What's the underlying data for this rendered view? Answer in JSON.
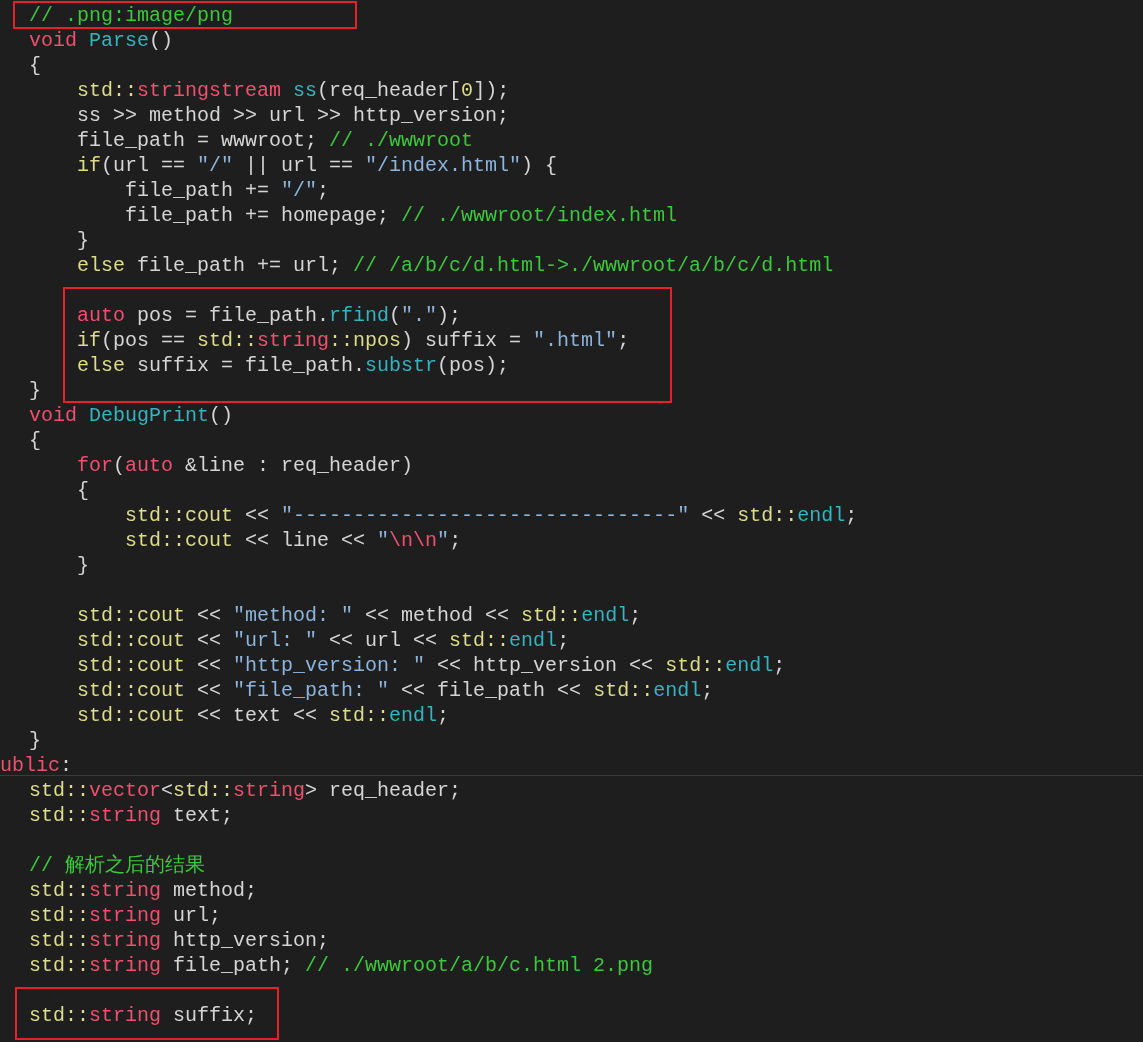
{
  "editor": {
    "lines": [
      {
        "kind": "code",
        "tokens": [
          {
            "text": "// .png:image/png",
            "kind": "comment"
          }
        ]
      },
      {
        "kind": "code",
        "tokens": [
          {
            "text": "void",
            "kind": "keyword"
          },
          {
            "text": " Parse",
            "kind": "func"
          },
          {
            "text": "()",
            "kind": "plain"
          }
        ]
      },
      {
        "kind": "code",
        "tokens": [
          {
            "text": "{",
            "kind": "plain"
          }
        ]
      },
      {
        "kind": "code",
        "tokens": [
          {
            "text": "    std::",
            "kind": "ns"
          },
          {
            "text": "stringstream",
            "kind": "keyword"
          },
          {
            "text": " ss",
            "kind": "func"
          },
          {
            "text": "(req_header[",
            "kind": "plain"
          },
          {
            "text": "0",
            "kind": "ns"
          },
          {
            "text": "]);",
            "kind": "plain"
          }
        ]
      },
      {
        "kind": "code",
        "tokens": [
          {
            "text": "    ss >> method >> url >> http_version;",
            "kind": "plain"
          }
        ]
      },
      {
        "kind": "code",
        "tokens": [
          {
            "text": "    file_path = wwwroot; ",
            "kind": "plain"
          },
          {
            "text": "// ./wwwroot",
            "kind": "comment"
          }
        ]
      },
      {
        "kind": "code",
        "tokens": [
          {
            "text": "    if",
            "kind": "ns"
          },
          {
            "text": "(url == ",
            "kind": "plain"
          },
          {
            "text": "\"/\"",
            "kind": "string"
          },
          {
            "text": " || url == ",
            "kind": "plain"
          },
          {
            "text": "\"/index.html\"",
            "kind": "string"
          },
          {
            "text": ") {",
            "kind": "plain"
          }
        ]
      },
      {
        "kind": "code",
        "tokens": [
          {
            "text": "        file_path += ",
            "kind": "plain"
          },
          {
            "text": "\"/\"",
            "kind": "string"
          },
          {
            "text": ";",
            "kind": "plain"
          }
        ]
      },
      {
        "kind": "code",
        "tokens": [
          {
            "text": "        file_path += homepage; ",
            "kind": "plain"
          },
          {
            "text": "// ./wwwroot/index.html",
            "kind": "comment"
          }
        ]
      },
      {
        "kind": "code",
        "tokens": [
          {
            "text": "    }",
            "kind": "plain"
          }
        ]
      },
      {
        "kind": "code",
        "tokens": [
          {
            "text": "    else",
            "kind": "ns"
          },
          {
            "text": " file_path += url; ",
            "kind": "plain"
          },
          {
            "text": "// /a/b/c/d.html->./wwwroot/a/b/c/d.html",
            "kind": "comment"
          }
        ]
      },
      {
        "kind": "blank"
      },
      {
        "kind": "code",
        "tokens": [
          {
            "text": "    auto",
            "kind": "keyword"
          },
          {
            "text": " pos = file_path.",
            "kind": "plain"
          },
          {
            "text": "rfind",
            "kind": "func"
          },
          {
            "text": "(",
            "kind": "plain"
          },
          {
            "text": "\".\"",
            "kind": "string"
          },
          {
            "text": ");",
            "kind": "plain"
          }
        ]
      },
      {
        "kind": "code",
        "tokens": [
          {
            "text": "    if",
            "kind": "ns"
          },
          {
            "text": "(pos == ",
            "kind": "plain"
          },
          {
            "text": "std::",
            "kind": "ns"
          },
          {
            "text": "string",
            "kind": "keyword"
          },
          {
            "text": "::npos",
            "kind": "ns"
          },
          {
            "text": ") suffix = ",
            "kind": "plain"
          },
          {
            "text": "\".html\"",
            "kind": "string"
          },
          {
            "text": ";",
            "kind": "plain"
          }
        ]
      },
      {
        "kind": "code",
        "tokens": [
          {
            "text": "    else",
            "kind": "ns"
          },
          {
            "text": " suffix = file_path.",
            "kind": "plain"
          },
          {
            "text": "substr",
            "kind": "func"
          },
          {
            "text": "(pos);",
            "kind": "plain"
          }
        ]
      },
      {
        "kind": "code",
        "tokens": [
          {
            "text": "}",
            "kind": "plain"
          }
        ]
      },
      {
        "kind": "code",
        "tokens": [
          {
            "text": "void",
            "kind": "keyword"
          },
          {
            "text": " DebugPrint",
            "kind": "func"
          },
          {
            "text": "()",
            "kind": "plain"
          }
        ]
      },
      {
        "kind": "code",
        "tokens": [
          {
            "text": "{",
            "kind": "plain"
          }
        ]
      },
      {
        "kind": "code",
        "tokens": [
          {
            "text": "    for",
            "kind": "keyword"
          },
          {
            "text": "(",
            "kind": "plain"
          },
          {
            "text": "auto",
            "kind": "keyword"
          },
          {
            "text": " &line : req_header)",
            "kind": "plain"
          }
        ]
      },
      {
        "kind": "code",
        "tokens": [
          {
            "text": "    {",
            "kind": "plain"
          }
        ]
      },
      {
        "kind": "code",
        "tokens": [
          {
            "text": "        std::cout",
            "kind": "ns"
          },
          {
            "text": " << ",
            "kind": "plain"
          },
          {
            "text": "\"--------------------------------\"",
            "kind": "string"
          },
          {
            "text": " << ",
            "kind": "plain"
          },
          {
            "text": "std::",
            "kind": "ns"
          },
          {
            "text": "endl",
            "kind": "func"
          },
          {
            "text": ";",
            "kind": "plain"
          }
        ]
      },
      {
        "kind": "code",
        "tokens": [
          {
            "text": "        std::cout",
            "kind": "ns"
          },
          {
            "text": " << line << ",
            "kind": "plain"
          },
          {
            "text": "\"",
            "kind": "string"
          },
          {
            "text": "\\n\\n",
            "kind": "escape"
          },
          {
            "text": "\"",
            "kind": "string"
          },
          {
            "text": ";",
            "kind": "plain"
          }
        ]
      },
      {
        "kind": "code",
        "tokens": [
          {
            "text": "    }",
            "kind": "plain"
          }
        ]
      },
      {
        "kind": "blank"
      },
      {
        "kind": "code",
        "tokens": [
          {
            "text": "    std::cout",
            "kind": "ns"
          },
          {
            "text": " << ",
            "kind": "plain"
          },
          {
            "text": "\"method: \"",
            "kind": "string"
          },
          {
            "text": " << method << ",
            "kind": "plain"
          },
          {
            "text": "std::",
            "kind": "ns"
          },
          {
            "text": "endl",
            "kind": "func"
          },
          {
            "text": ";",
            "kind": "plain"
          }
        ]
      },
      {
        "kind": "code",
        "tokens": [
          {
            "text": "    std::cout",
            "kind": "ns"
          },
          {
            "text": " << ",
            "kind": "plain"
          },
          {
            "text": "\"url: \"",
            "kind": "string"
          },
          {
            "text": " << url << ",
            "kind": "plain"
          },
          {
            "text": "std::",
            "kind": "ns"
          },
          {
            "text": "endl",
            "kind": "func"
          },
          {
            "text": ";",
            "kind": "plain"
          }
        ]
      },
      {
        "kind": "code",
        "tokens": [
          {
            "text": "    std::cout",
            "kind": "ns"
          },
          {
            "text": " << ",
            "kind": "plain"
          },
          {
            "text": "\"http_version: \"",
            "kind": "string"
          },
          {
            "text": " << http_version << ",
            "kind": "plain"
          },
          {
            "text": "std::",
            "kind": "ns"
          },
          {
            "text": "endl",
            "kind": "func"
          },
          {
            "text": ";",
            "kind": "plain"
          }
        ]
      },
      {
        "kind": "code",
        "tokens": [
          {
            "text": "    std::cout",
            "kind": "ns"
          },
          {
            "text": " << ",
            "kind": "plain"
          },
          {
            "text": "\"file_path: \"",
            "kind": "string"
          },
          {
            "text": " << file_path << ",
            "kind": "plain"
          },
          {
            "text": "std::",
            "kind": "ns"
          },
          {
            "text": "endl",
            "kind": "func"
          },
          {
            "text": ";",
            "kind": "plain"
          }
        ]
      },
      {
        "kind": "code",
        "tokens": [
          {
            "text": "    std::cout",
            "kind": "ns"
          },
          {
            "text": " << text << ",
            "kind": "plain"
          },
          {
            "text": "std::",
            "kind": "ns"
          },
          {
            "text": "endl",
            "kind": "func"
          },
          {
            "text": ";",
            "kind": "plain"
          }
        ]
      },
      {
        "kind": "code",
        "tokens": [
          {
            "text": "}",
            "kind": "plain"
          }
        ]
      },
      {
        "kind": "label",
        "tokens": [
          {
            "text": "ublic",
            "kind": "keyword"
          },
          {
            "text": ":",
            "kind": "plain"
          }
        ]
      },
      {
        "kind": "code",
        "tokens": [
          {
            "text": "std::",
            "kind": "ns"
          },
          {
            "text": "vector",
            "kind": "keyword"
          },
          {
            "text": "<",
            "kind": "plain"
          },
          {
            "text": "std::",
            "kind": "ns"
          },
          {
            "text": "string",
            "kind": "keyword"
          },
          {
            "text": "> req_header;",
            "kind": "plain"
          }
        ]
      },
      {
        "kind": "code",
        "tokens": [
          {
            "text": "std::",
            "kind": "ns"
          },
          {
            "text": "string",
            "kind": "keyword"
          },
          {
            "text": " text;",
            "kind": "plain"
          }
        ]
      },
      {
        "kind": "blank"
      },
      {
        "kind": "code",
        "tokens": [
          {
            "text": "// 解析之后的结果",
            "kind": "comment"
          }
        ]
      },
      {
        "kind": "code",
        "tokens": [
          {
            "text": "std::",
            "kind": "ns"
          },
          {
            "text": "string",
            "kind": "keyword"
          },
          {
            "text": " method;",
            "kind": "plain"
          }
        ]
      },
      {
        "kind": "code",
        "tokens": [
          {
            "text": "std::",
            "kind": "ns"
          },
          {
            "text": "string",
            "kind": "keyword"
          },
          {
            "text": " url;",
            "kind": "plain"
          }
        ]
      },
      {
        "kind": "code",
        "tokens": [
          {
            "text": "std::",
            "kind": "ns"
          },
          {
            "text": "string",
            "kind": "keyword"
          },
          {
            "text": " http_version;",
            "kind": "plain"
          }
        ]
      },
      {
        "kind": "code",
        "tokens": [
          {
            "text": "std::",
            "kind": "ns"
          },
          {
            "text": "string",
            "kind": "keyword"
          },
          {
            "text": " file_path; ",
            "kind": "plain"
          },
          {
            "text": "// ./wwwroot/a/b/c.html 2.png",
            "kind": "comment"
          }
        ]
      },
      {
        "kind": "blank"
      },
      {
        "kind": "code",
        "tokens": [
          {
            "text": "std::",
            "kind": "ns"
          },
          {
            "text": "string",
            "kind": "keyword"
          },
          {
            "text": " suffix;",
            "kind": "plain"
          }
        ]
      }
    ]
  }
}
